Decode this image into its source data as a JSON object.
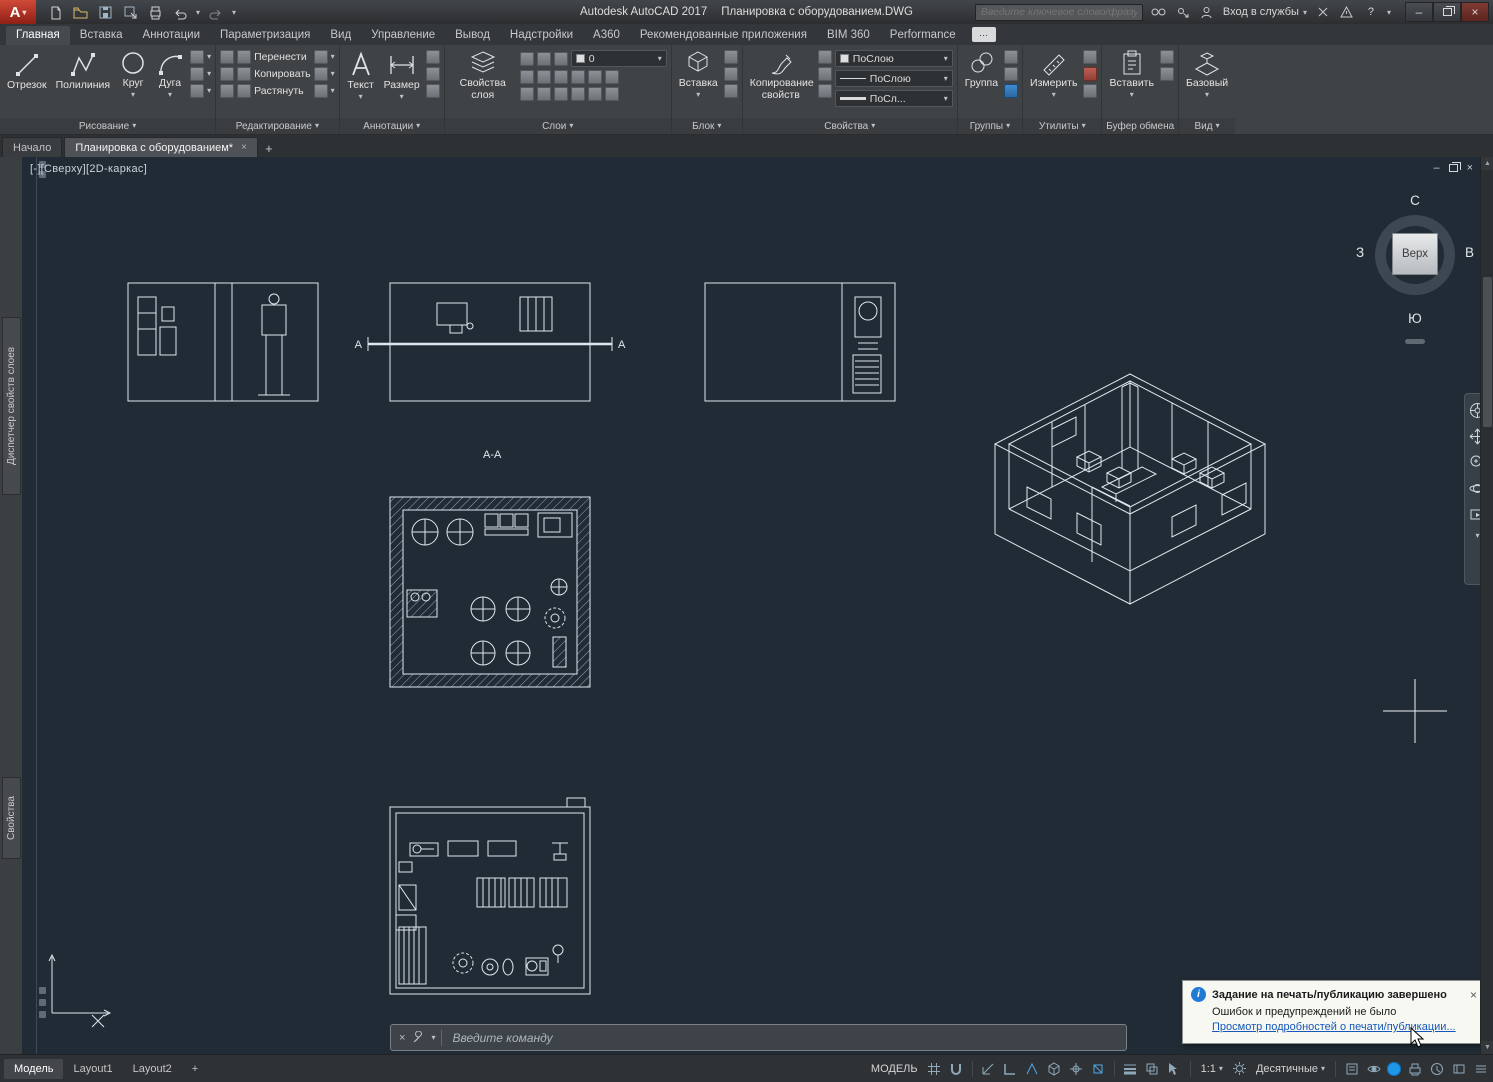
{
  "icons": {
    "chevron_down": "▾",
    "chevron_right": "»",
    "close": "×",
    "minimize": "–",
    "plus": "+",
    "arrow_up": "▲",
    "arrow_down": "▼",
    "question": "?",
    "ellipsis": "···"
  },
  "titlebar": {
    "app_name": "Autodesk AutoCAD 2017",
    "doc_name": "Планировка с оборудованием.DWG",
    "search_placeholder": "Введите ключевое слово/фразу",
    "signin": "Вход в службы"
  },
  "ribbon_tabs": [
    {
      "label": "Главная"
    },
    {
      "label": "Вставка"
    },
    {
      "label": "Аннотации"
    },
    {
      "label": "Параметризация"
    },
    {
      "label": "Вид"
    },
    {
      "label": "Управление"
    },
    {
      "label": "Вывод"
    },
    {
      "label": "Надстройки"
    },
    {
      "label": "A360"
    },
    {
      "label": "Рекомендованные приложения"
    },
    {
      "label": "BIM 360"
    },
    {
      "label": "Performance"
    }
  ],
  "panels": {
    "draw": {
      "title": "Рисование",
      "line": "Отрезок",
      "polyline": "Полилиния",
      "circle": "Круг",
      "arc": "Дуга"
    },
    "modify": {
      "title": "Редактирование",
      "move": "Перенести",
      "copy": "Копировать",
      "stretch": "Растянуть"
    },
    "annotation": {
      "title": "Аннотации",
      "text": "Текст",
      "dimension": "Размер"
    },
    "layers": {
      "title": "Слои",
      "layer_props": "Свойства слоя",
      "current_layer": "0"
    },
    "block": {
      "title": "Блок",
      "insert": "Вставка"
    },
    "properties": {
      "title": "Свойства",
      "match": "Копирование свойств",
      "color": "ПоСлою",
      "linetype": "ПоСлою",
      "lineweight": "ПоСл..."
    },
    "groups": {
      "title": "Группы",
      "group": "Группа"
    },
    "utilities": {
      "title": "Утилиты",
      "measure": "Измерить"
    },
    "clipboard": {
      "title": "Буфер обмена",
      "paste": "Вставить"
    },
    "view": {
      "title": "Вид",
      "base": "Базовый"
    }
  },
  "file_tabs": {
    "start": "Начало",
    "drawing": "Планировка с оборудованием*"
  },
  "viewport": {
    "label": "[-][Сверху][2D-каркас]",
    "viewcube_top": "Верх",
    "compass_n": "С",
    "compass_s": "Ю",
    "compass_w": "З",
    "compass_e": "В",
    "section_label": "А-А",
    "section_marker_left": "А",
    "section_marker_right": "А"
  },
  "palettes": {
    "layer_manager": "Диспетчер свойств слоев",
    "properties": "Свойства"
  },
  "command_line": {
    "placeholder": "Введите команду"
  },
  "notification": {
    "title": "Задание на печать/публикацию завершено",
    "body": "Ошибок и предупреждений не было",
    "link": "Просмотр подробностей о печати/публикации..."
  },
  "statusbar": {
    "model_tab": "Модель",
    "layout1": "Layout1",
    "layout2": "Layout2",
    "model_space": "МОДЕЛЬ",
    "scale": "1:1",
    "units": "Десятичные"
  }
}
